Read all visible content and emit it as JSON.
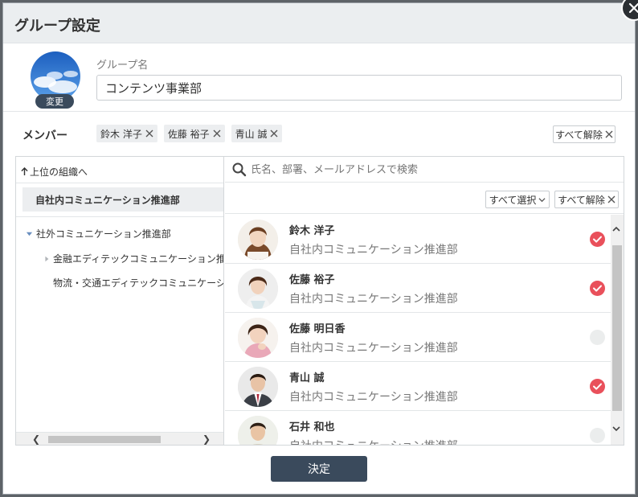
{
  "dialog": {
    "title": "グループ設定",
    "submit_label": "決定"
  },
  "group": {
    "avatar_change_label": "変更",
    "name_label": "グループ名",
    "name_value": "コンテンツ事業部"
  },
  "members": {
    "label": "メンバー",
    "chips": [
      "鈴木 洋子",
      "佐藤 裕子",
      "青山 誠"
    ],
    "clear_all_label": "すべて解除"
  },
  "org_tree": {
    "up_label": "上位の組織へ",
    "selected": "自社内コミュニケーション推進部",
    "items": [
      {
        "label": "社外コミュニケーション推進部",
        "expanded": true,
        "level": 0
      },
      {
        "label": "金融エディテックコミュニケーション推進部",
        "expanded": false,
        "level": 1
      },
      {
        "label": "物流・交通エディテックコミュニケーション推進部",
        "expanded": false,
        "level": 1
      }
    ]
  },
  "search": {
    "placeholder": "氏名、部署、メールアドレスで検索"
  },
  "list_actions": {
    "select_all_label": "すべて選択",
    "clear_all_label": "すべて解除"
  },
  "people": [
    {
      "name": "鈴木 洋子",
      "dept": "自社内コミュニケーション推進部",
      "selected": true
    },
    {
      "name": "佐藤 裕子",
      "dept": "自社内コミュニケーション推進部",
      "selected": true
    },
    {
      "name": "佐藤 明日香",
      "dept": "自社内コミュニケーション推進部",
      "selected": false
    },
    {
      "name": "青山 誠",
      "dept": "自社内コミュニケーション推進部",
      "selected": true
    },
    {
      "name": "石井 和也",
      "dept": "自社内コミュニケーション推進部",
      "selected": false
    }
  ],
  "colors": {
    "accent_dark": "#3a4a5c",
    "check_on": "#e9505b"
  }
}
